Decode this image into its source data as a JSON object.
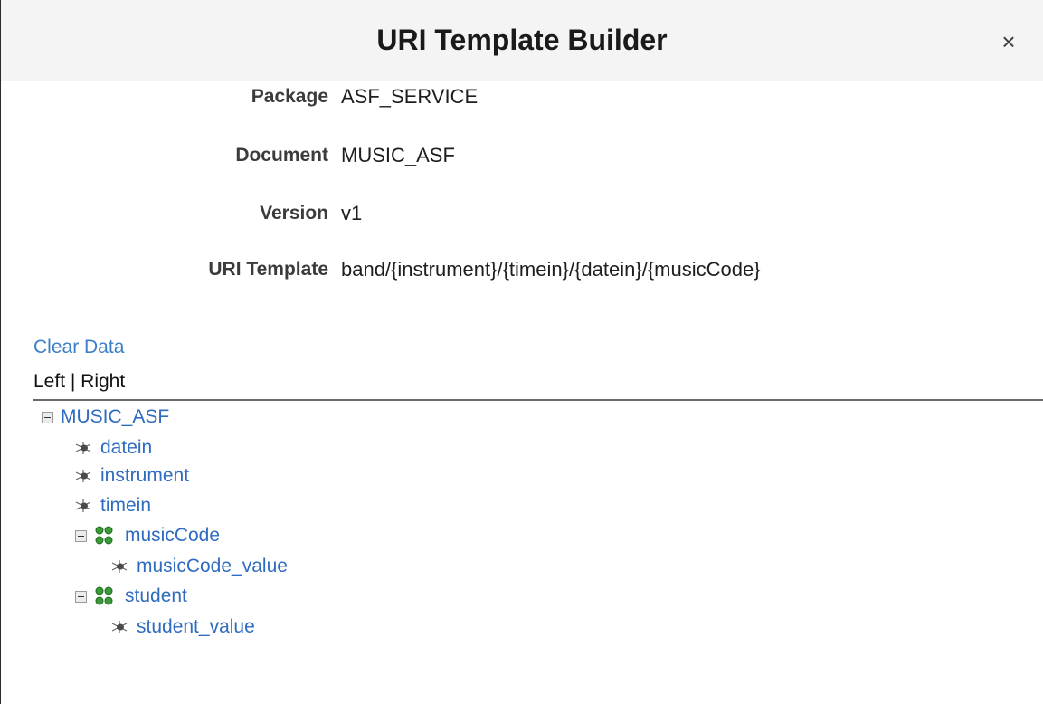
{
  "dialog": {
    "title": "URI Template Builder",
    "close_symbol": "×"
  },
  "fields": {
    "package": {
      "label": "Package",
      "value": "ASF_SERVICE"
    },
    "document": {
      "label": "Document",
      "value": "MUSIC_ASF"
    },
    "version": {
      "label": "Version",
      "value": "v1"
    },
    "uri_template": {
      "label": "URI Template",
      "value": "band/{instrument}/{timein}/{datein}/{musicCode}"
    }
  },
  "actions": {
    "clear_data": "Clear Data",
    "left_right": "Left | Right"
  },
  "tree": {
    "root": {
      "label": "MUSIC_ASF",
      "expanded": true
    },
    "nodes": [
      {
        "label": "datein",
        "icon": "element-icon"
      },
      {
        "label": "instrument",
        "icon": "element-icon"
      },
      {
        "label": "timein",
        "icon": "element-icon"
      },
      {
        "label": "musicCode",
        "icon": "collection-icon",
        "expanded": true
      },
      {
        "label": "musicCode_value",
        "icon": "element-icon"
      },
      {
        "label": "student",
        "icon": "collection-icon",
        "expanded": true
      },
      {
        "label": "student_value",
        "icon": "element-icon"
      }
    ]
  },
  "colors": {
    "link": "#2f6cc0",
    "header_bg": "#f4f4f4",
    "group_icon": "#3a9a3a"
  }
}
